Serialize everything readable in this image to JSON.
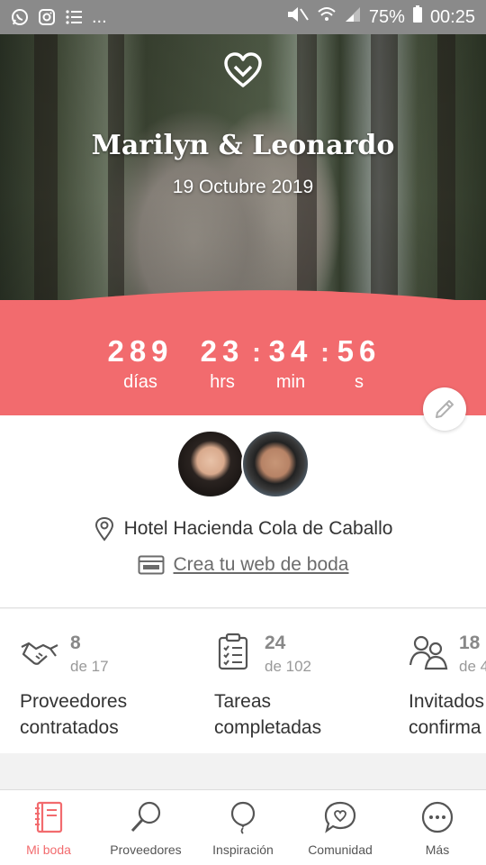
{
  "status_bar": {
    "left_icons": [
      "whatsapp-icon",
      "instagram-icon",
      "list-icon"
    ],
    "left_more": "...",
    "battery_percent": "75%",
    "time": "00:25"
  },
  "hero": {
    "names": "Marilyn & Leonardo",
    "date": "19 Octubre 2019"
  },
  "countdown": {
    "days_value": "289",
    "days_label": "días",
    "hours_value": "23",
    "hours_label": "hrs",
    "minutes_value": "34",
    "minutes_label": "min",
    "seconds_value": "56",
    "seconds_label": "s",
    "separator": ":"
  },
  "info": {
    "venue": "Hotel Hacienda Cola de Caballo",
    "web_link": "Crea tu web de boda"
  },
  "stats": [
    {
      "value": "8",
      "of": "de 17",
      "label_line1": "Proveedores",
      "label_line2": "contratados",
      "icon": "handshake-icon"
    },
    {
      "value": "24",
      "of": "de 102",
      "label_line1": "Tareas",
      "label_line2": "completadas",
      "icon": "clipboard-icon"
    },
    {
      "value": "18",
      "of": "de 4",
      "label_line1": "Invitados",
      "label_line2": "confirma",
      "icon": "guests-icon"
    }
  ],
  "tabs": [
    {
      "label": "Mi boda",
      "icon": "notebook-icon",
      "active": true
    },
    {
      "label": "Proveedores",
      "icon": "magnifier-icon"
    },
    {
      "label": "Inspiración",
      "icon": "balloon-icon"
    },
    {
      "label": "Comunidad",
      "icon": "chat-heart-icon"
    },
    {
      "label": "Más",
      "icon": "more-icon"
    }
  ],
  "colors": {
    "accent": "#f26b6e",
    "status_bar": "#8a8a8a"
  }
}
